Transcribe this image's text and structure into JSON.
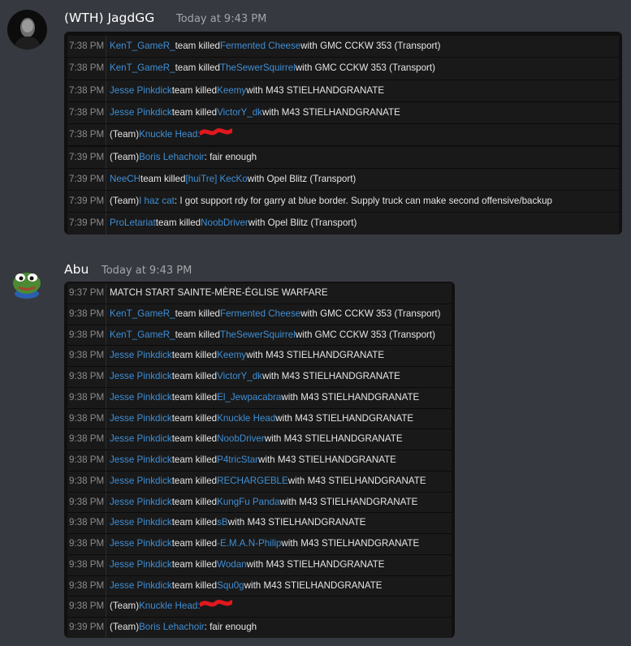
{
  "messages": [
    {
      "author": "(WTH) JagdGG",
      "timestamp": "Today at 9:43 PM",
      "avatar_icon": "dark-portrait-avatar",
      "log_rows": [
        {
          "time": "7:38 PM",
          "a": "KenT_GameR_",
          "mid": " team killed ",
          "b": "Fermented Cheese",
          "end": " with GMC CCKW 353 (Transport)"
        },
        {
          "time": "7:38 PM",
          "a": "KenT_GameR_",
          "mid": " team killed ",
          "b": "TheSewerSquirrel",
          "end": " with GMC CCKW 353 (Transport)"
        },
        {
          "time": "7:38 PM",
          "a": "Jesse Pinkdick",
          "mid": " team killed ",
          "b": "Keemy",
          "end": " with M43 STIELHANDGRANATE"
        },
        {
          "time": "7:38 PM",
          "a": "Jesse Pinkdick",
          "mid": " team killed ",
          "b": "VictorY_dk",
          "end": " with M43 STIELHANDGRANATE"
        },
        {
          "time": "7:38 PM",
          "pre": "(Team) ",
          "a": "Knuckle Head:",
          "scribble": true
        },
        {
          "time": "7:39 PM",
          "pre": "(Team) ",
          "a": "Boris Lehachoir",
          "end": ": fair enough"
        },
        {
          "time": "7:39 PM",
          "a": "NeeCH",
          "mid": " team killed ",
          "b": "[huiTre] KecKo",
          "end": " with Opel Blitz (Transport)"
        },
        {
          "time": "7:39 PM",
          "pre": "(Team) ",
          "a": "I haz cat",
          "end": ": I got support rdy for garry at blue border. Supply truck can make second offensive/backup"
        },
        {
          "time": "7:39 PM",
          "a": "ProLetariat",
          "mid": " team killed ",
          "b": "NoobDriver",
          "end": " with Opel Blitz (Transport)"
        }
      ]
    },
    {
      "author": "Abu",
      "timestamp": "Today at 9:43 PM",
      "avatar_icon": "green-frog-avatar",
      "log_rows": [
        {
          "time": "9:37 PM",
          "plain": "MATCH START SAINTE-MÈRE-ÉGLISE WARFARE"
        },
        {
          "time": "9:38 PM",
          "a": "KenT_GameR_",
          "mid": " team killed ",
          "b": "Fermented Cheese",
          "end": " with GMC CCKW 353 (Transport)"
        },
        {
          "time": "9:38 PM",
          "a": "KenT_GameR_",
          "mid": " team killed ",
          "b": "TheSewerSquirrel",
          "end": " with GMC CCKW 353 (Transport)"
        },
        {
          "time": "9:38 PM",
          "a": "Jesse Pinkdick",
          "mid": " team killed ",
          "b": "Keemy",
          "end": " with M43 STIELHANDGRANATE"
        },
        {
          "time": "9:38 PM",
          "a": "Jesse Pinkdick",
          "mid": " team killed ",
          "b": "VictorY_dk",
          "end": " with M43 STIELHANDGRANATE"
        },
        {
          "time": "9:38 PM",
          "a": "Jesse Pinkdick",
          "mid": " team killed ",
          "b": "El_Jewpacabra",
          "end": " with M43 STIELHANDGRANATE"
        },
        {
          "time": "9:38 PM",
          "a": "Jesse Pinkdick",
          "mid": " team killed ",
          "b": "Knuckle Head",
          "end": " with M43 STIELHANDGRANATE"
        },
        {
          "time": "9:38 PM",
          "a": "Jesse Pinkdick",
          "mid": " team killed ",
          "b": "NoobDriver",
          "end": " with M43 STIELHANDGRANATE"
        },
        {
          "time": "9:38 PM",
          "a": "Jesse Pinkdick",
          "mid": " team killed ",
          "b": "P4tricStar",
          "end": " with M43 STIELHANDGRANATE"
        },
        {
          "time": "9:38 PM",
          "a": "Jesse Pinkdick",
          "mid": " team killed ",
          "b": "RECHARGEBLE",
          "end": " with M43 STIELHANDGRANATE"
        },
        {
          "time": "9:38 PM",
          "a": "Jesse Pinkdick",
          "mid": " team killed ",
          "b": "KungFu Panda",
          "end": " with M43 STIELHANDGRANATE"
        },
        {
          "time": "9:38 PM",
          "a": "Jesse Pinkdick",
          "mid": " team killed ",
          "b": "sB",
          "end": "  with M43 STIELHANDGRANATE"
        },
        {
          "time": "9:38 PM",
          "a": "Jesse Pinkdick",
          "mid": " team killed ",
          "b": "-E.M.A.N-Philip",
          "end": " with M43 STIELHANDGRANATE"
        },
        {
          "time": "9:38 PM",
          "a": "Jesse Pinkdick",
          "mid": " team killed ",
          "b": "Wodan",
          "end": " with M43 STIELHANDGRANATE"
        },
        {
          "time": "9:38 PM",
          "a": "Jesse Pinkdick",
          "mid": " team killed ",
          "b": "Squ0g",
          "end": " with M43 STIELHANDGRANATE"
        },
        {
          "time": "9:38 PM",
          "pre": "(Team) ",
          "a": "Knuckle Head:",
          "scribble": true
        },
        {
          "time": "9:39 PM",
          "pre": "(Team) ",
          "a": "Boris Lehachoir",
          "end": ": fair enough"
        }
      ]
    }
  ],
  "colors": {
    "background": "#36393f",
    "name_link": "#3f8fd6",
    "redaction": "#e0181e"
  }
}
